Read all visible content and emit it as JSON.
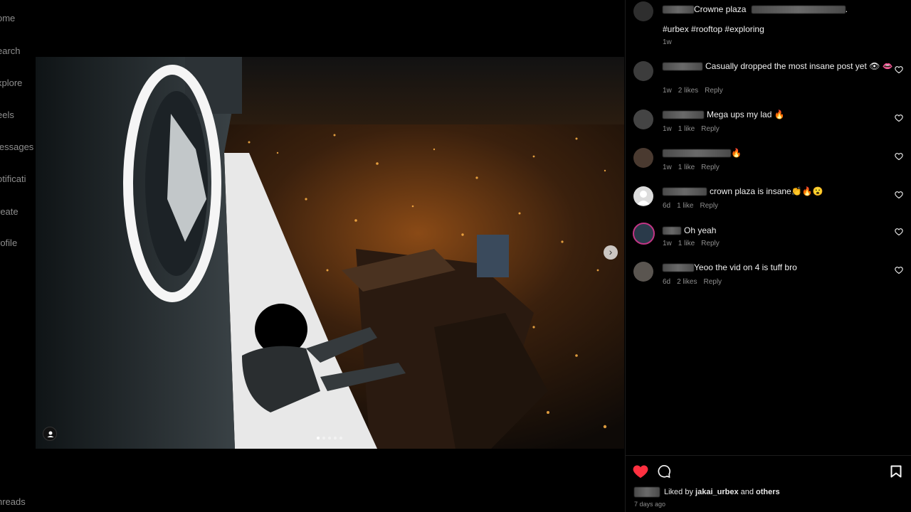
{
  "sidebar": {
    "items": [
      {
        "label": "ome"
      },
      {
        "label": "earch"
      },
      {
        "label": "xplore"
      },
      {
        "label": "eels"
      },
      {
        "label": "lessages"
      },
      {
        "label": "otificati"
      },
      {
        "label": "reate"
      },
      {
        "label": "rofile"
      },
      {
        "label": "nreads"
      }
    ]
  },
  "post": {
    "carousel": {
      "count": 5,
      "active": 0
    },
    "caption": {
      "prefix": "Crowne plaza",
      "suffix": ".",
      "hashtags": "#urbex #rooftop #exploring",
      "time": "1w"
    }
  },
  "comments": [
    {
      "text": "Casually dropped the most insane post yet 👁 👄",
      "time": "1w",
      "likes": "2 likes",
      "reply": "Reply"
    },
    {
      "text": "Mega ups my lad 🔥",
      "time": "1w",
      "likes": "1 like",
      "reply": "Reply"
    },
    {
      "text": "🔥",
      "time": "1w",
      "likes": "1 like",
      "reply": "Reply"
    },
    {
      "text": "crown plaza is insane👏🔥😮",
      "time": "6d",
      "likes": "1 like",
      "reply": "Reply"
    },
    {
      "text": "Oh yeah",
      "time": "1w",
      "likes": "1 like",
      "reply": "Reply"
    },
    {
      "text": "Yeoo the vid on 4 is tuff bro",
      "time": "6d",
      "likes": "2 likes",
      "reply": "Reply"
    }
  ],
  "footer": {
    "liked_prefix": "Liked by ",
    "liked_user": "jakai_urbex",
    "liked_mid": " and ",
    "liked_others": "others",
    "time_ago": "7 days ago"
  },
  "colors": {
    "like_red": "#ff3040",
    "muted": "#8e8e8e"
  }
}
